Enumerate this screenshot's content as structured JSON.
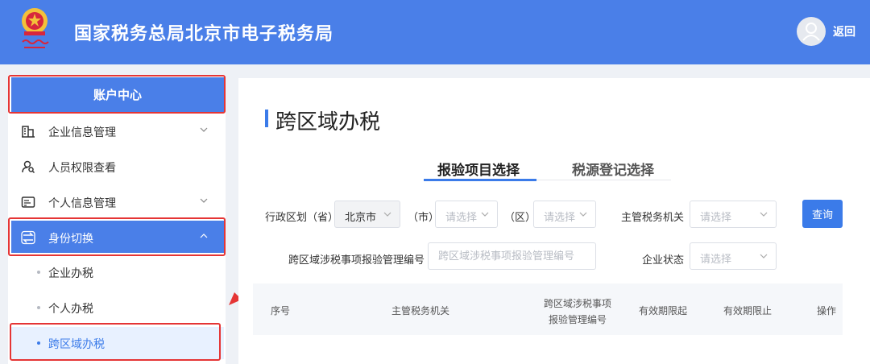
{
  "header": {
    "title": "国家税务总局北京市电子税务局",
    "return_label": "返回",
    "brand_color": "#4a7fe8"
  },
  "sidebar": {
    "account_center": "账户中心",
    "items": [
      {
        "label": "企业信息管理",
        "icon": "building-icon",
        "expandable": true
      },
      {
        "label": "人员权限查看",
        "icon": "user-search-icon",
        "expandable": false
      },
      {
        "label": "个人信息管理",
        "icon": "id-card-icon",
        "expandable": true
      },
      {
        "label": "身份切换",
        "icon": "switch-icon",
        "expandable": true,
        "active": true
      }
    ],
    "sub_items": [
      {
        "label": "企业办税"
      },
      {
        "label": "个人办税"
      },
      {
        "label": "跨区域办税",
        "selected": true
      }
    ]
  },
  "main": {
    "title": "跨区域办税",
    "tabs": [
      {
        "label": "报验项目选择",
        "active": true
      },
      {
        "label": "税源登记选择",
        "active": false
      }
    ],
    "filters": {
      "region_province_label": "行政区划（省）",
      "province_value": "北京市",
      "city_label": "（市）",
      "city_placeholder": "请选择",
      "district_label": "（区）",
      "district_placeholder": "请选择",
      "tax_authority_label": "主管税务机关",
      "tax_authority_placeholder": "请选择",
      "query_button": "查询",
      "report_no_label": "跨区域涉税事项报验管理编号",
      "report_no_placeholder": "跨区域涉税事项报验管理编号",
      "status_label": "企业状态",
      "status_placeholder": "请选择"
    },
    "table_headers": {
      "seq": "序号",
      "authority": "主管税务机关",
      "report_no_line1": "跨区域涉税事项",
      "report_no_line2": "报验管理编号",
      "valid_from": "有效期限起",
      "valid_to": "有效期限止",
      "action": "操作"
    }
  }
}
